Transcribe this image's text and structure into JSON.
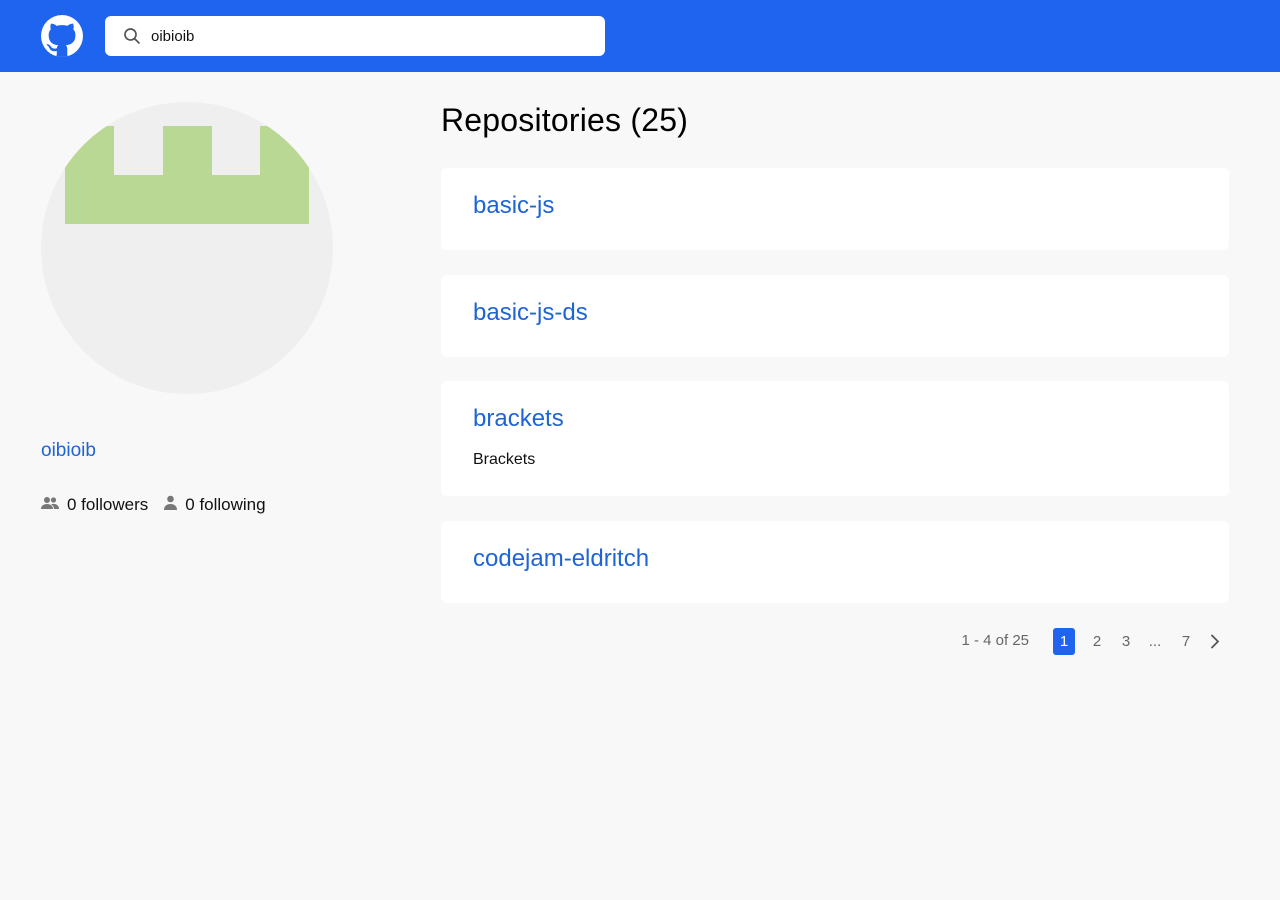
{
  "header": {
    "logo_icon": "github-icon",
    "search_icon": "search-icon",
    "search_value": "oibioib",
    "background": "#1e64ef"
  },
  "profile": {
    "avatar_icon": "identicon-avatar",
    "avatar_color": "#b9d893",
    "username": "oibioib",
    "followers_count_label": "0 followers",
    "following_count_label": "0 following",
    "followers_icon": "people-icon",
    "following_icon": "person-icon"
  },
  "repositories": {
    "heading": "Repositories (25)",
    "items": [
      {
        "name": "basic-js",
        "description": ""
      },
      {
        "name": "basic-js-ds",
        "description": ""
      },
      {
        "name": "brackets",
        "description": "Brackets"
      },
      {
        "name": "codejam-eldritch",
        "description": ""
      }
    ]
  },
  "pagination": {
    "summary": "1 - 4 of 25",
    "pages": [
      "1",
      "2",
      "3",
      "...",
      "7"
    ],
    "active_page": "1",
    "next_icon": "chevron-right-icon",
    "accent": "#1e64ef"
  }
}
